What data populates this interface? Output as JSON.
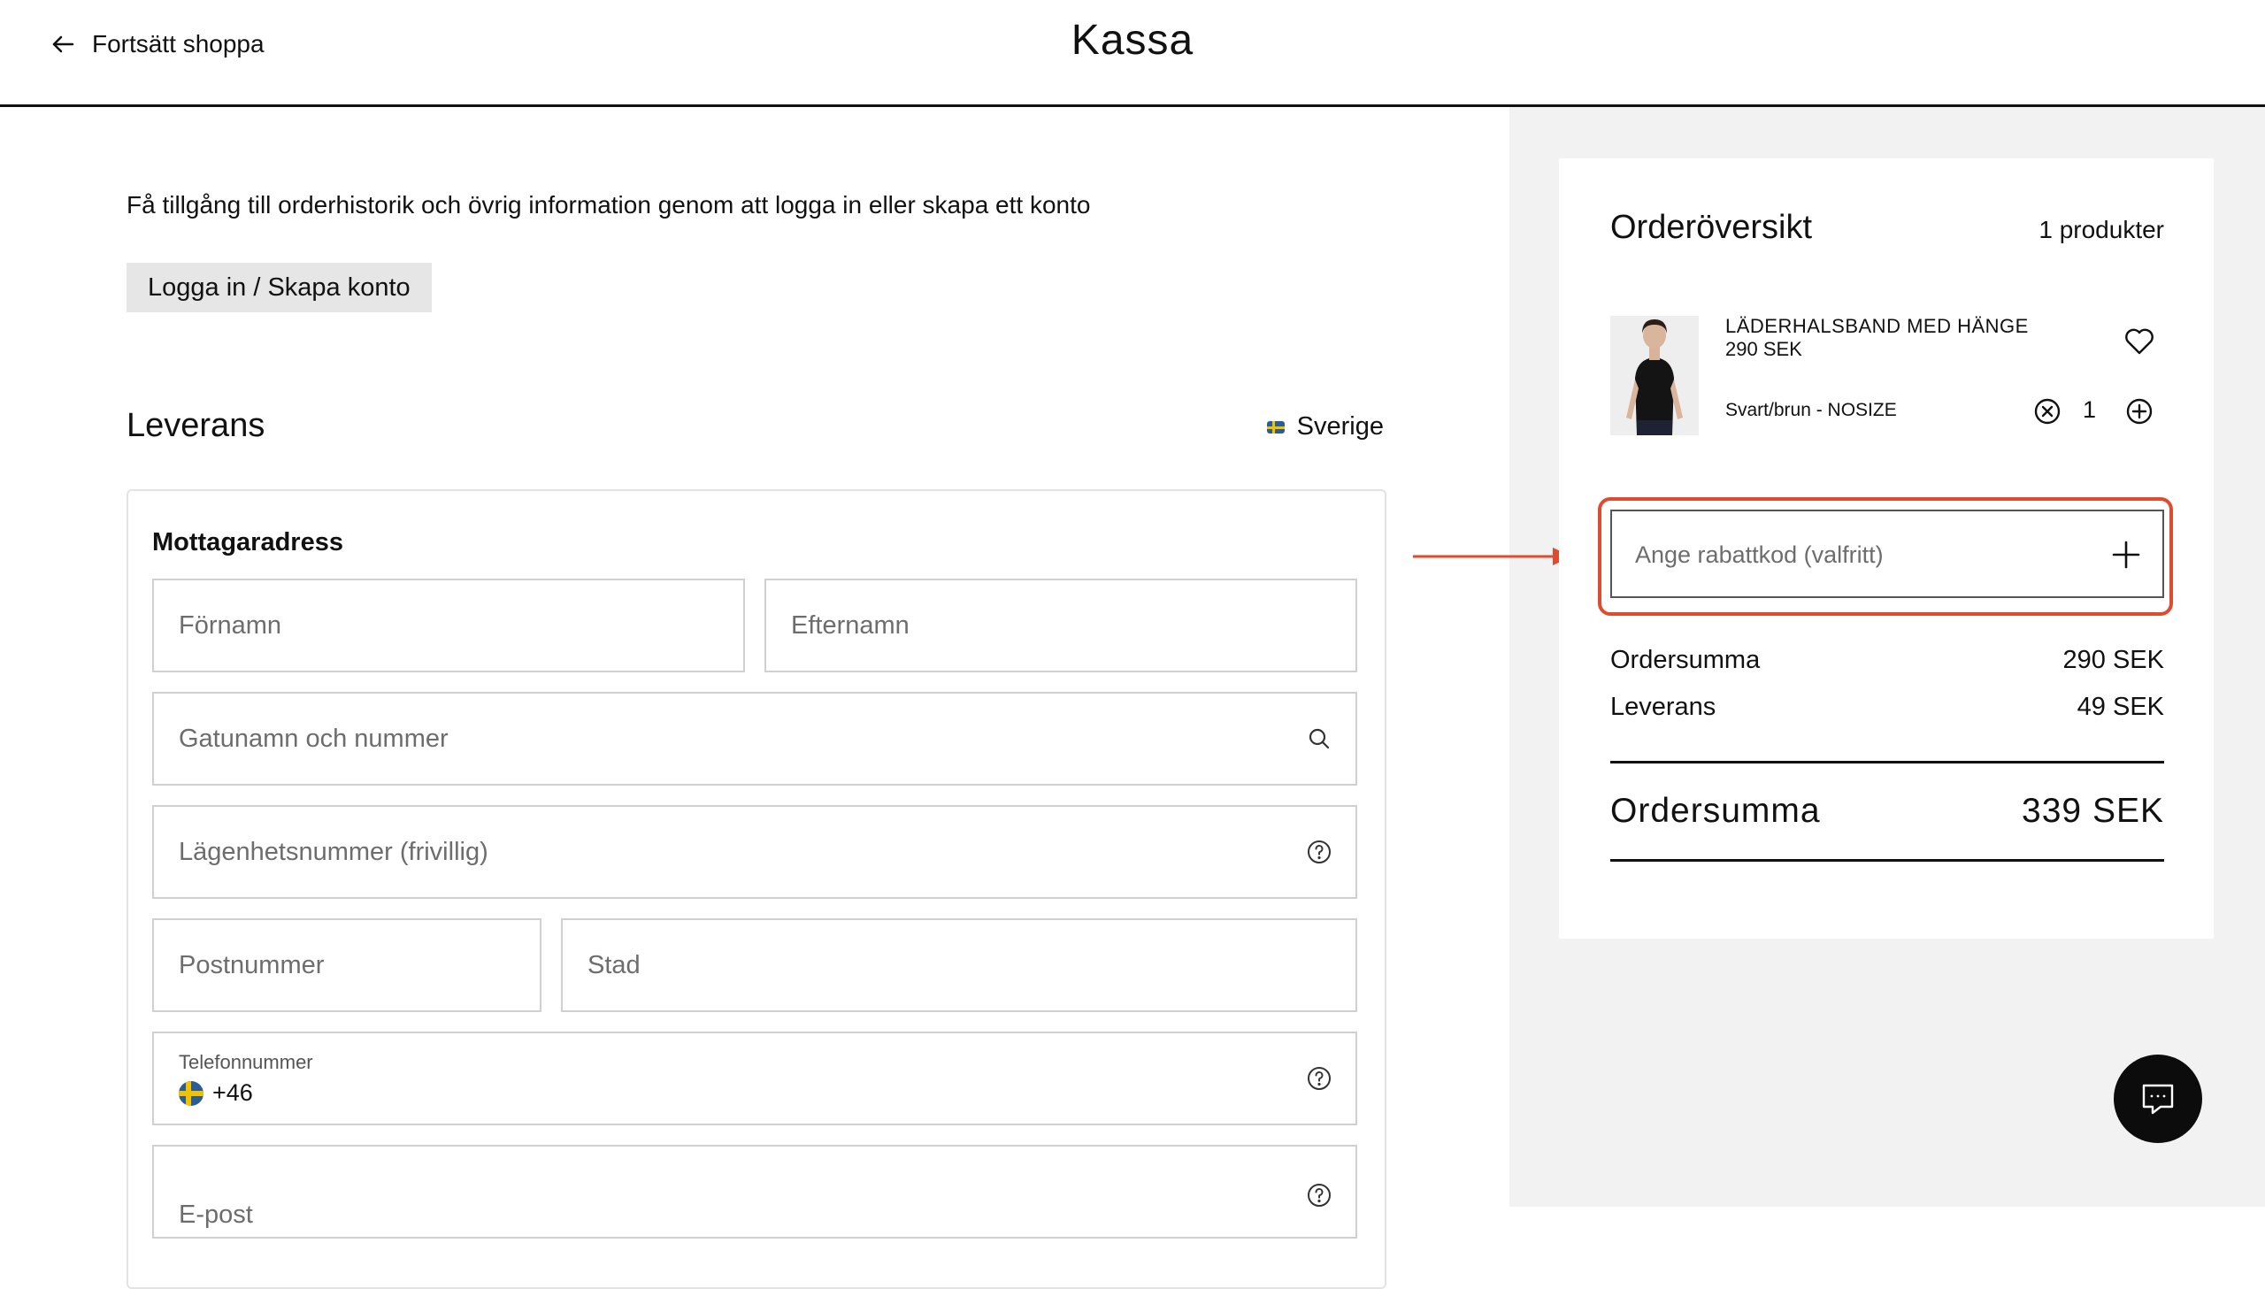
{
  "header": {
    "back_label": "Fortsätt shoppa",
    "title": "Kassa"
  },
  "intro": {
    "text": "Få tillgång till orderhistorik och övrig information genom att logga in eller skapa ett konto",
    "login_button": "Logga in / Skapa konto"
  },
  "delivery": {
    "title": "Leverans",
    "country": "Sverige",
    "form_heading": "Mottagaradress",
    "fields": {
      "first_name": "Förnamn",
      "last_name": "Efternamn",
      "street": "Gatunamn och nummer",
      "apartment": "Lägenhetsnummer (frivillig)",
      "postcode": "Postnummer",
      "city": "Stad",
      "phone_label": "Telefonnummer",
      "phone_prefix": "+46",
      "email": "E-post"
    }
  },
  "summary": {
    "title": "Orderöversikt",
    "count": "1 produkter",
    "product": {
      "name": "LÄDERHALSBAND MED HÄNGE",
      "price": "290 SEK",
      "variant": "Svart/brun - NOSIZE",
      "quantity": "1"
    },
    "discount_placeholder": "Ange rabattkod (valfritt)",
    "subtotal_label": "Ordersumma",
    "subtotal_value": "290 SEK",
    "shipping_label": "Leverans",
    "shipping_value": "49 SEK",
    "total_label": "Ordersumma",
    "total_value": "339 SEK"
  },
  "colors": {
    "highlight": "#e04a2f",
    "panel_bg": "#f2f2f2"
  },
  "icons": [
    "arrow-left-icon",
    "search-icon",
    "help-icon",
    "heart-icon",
    "remove-circle-icon",
    "add-circle-icon",
    "plus-icon",
    "chat-icon",
    "flag-se-icon"
  ]
}
